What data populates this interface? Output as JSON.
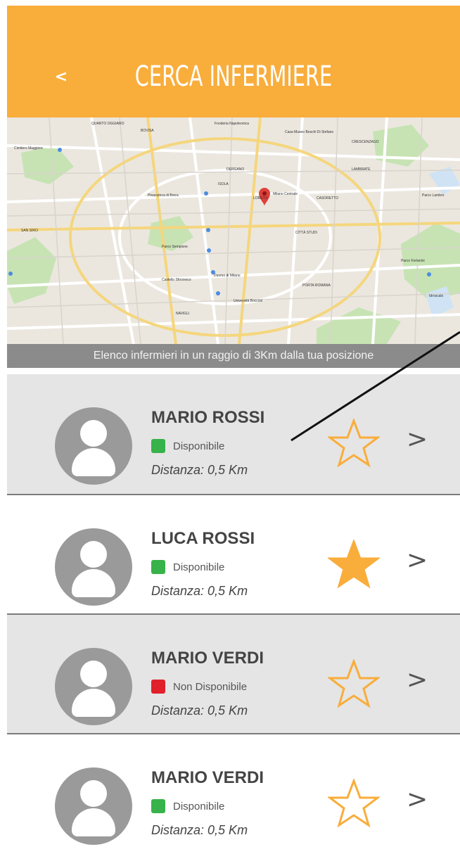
{
  "header": {
    "back_label": "<",
    "title": "CERCA INFERMIERE",
    "background": "#f9ad3b"
  },
  "map": {
    "places": [
      "QUARTO OGGIARO",
      "Cimitero Maggiore",
      "BOVISA",
      "Fonderia Napoleonica",
      "Casa Museo Boschi Di Stefano",
      "CRESCENZAGO",
      "DERGANO",
      "Pinacoteca di Brera",
      "Milano Centrale",
      "Parco Sempione",
      "LORETO",
      "CITTÀ STUDI",
      "Duomo di Milano",
      "Castello Sforzesco",
      "PORTA ROMANA",
      "Parco Forlanini",
      "LAMBRATE",
      "NAVIGLI",
      "CASORETTO",
      "Parco Lambro",
      "Idroscalo",
      "ISOLA",
      "SAN SIRO",
      "Università Bocconi"
    ]
  },
  "caption": "Elenco infermieri in un raggio di 3Km dalla tua posizione",
  "chevron_label": ">",
  "nurses": [
    {
      "name": "MARIO ROSSI",
      "status": "Disponibile",
      "status_color": "#38b24a",
      "distance": "Distanza: 0,5 Km",
      "favorite": false
    },
    {
      "name": "LUCA ROSSI",
      "status": "Disponibile",
      "status_color": "#38b24a",
      "distance": "Distanza: 0,5 Km",
      "favorite": true
    },
    {
      "name": "MARIO VERDI",
      "status": "Non Disponibile",
      "status_color": "#e0202a",
      "distance": "Distanza: 0,5 Km",
      "favorite": false
    },
    {
      "name": "MARIO VERDI",
      "status": "Disponibile",
      "status_color": "#38b24a",
      "distance": "Distanza: 0,5 Km",
      "favorite": false
    }
  ],
  "colors": {
    "accent": "#f9ad3b",
    "available": "#38b24a",
    "unavailable": "#e0202a",
    "row_shade": "#e5e5e5"
  }
}
